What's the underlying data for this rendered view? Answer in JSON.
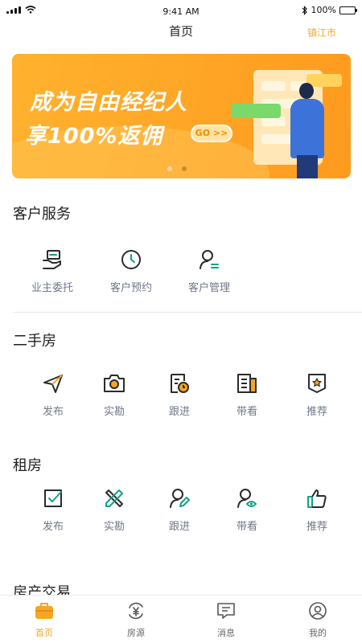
{
  "status_bar": {
    "time": "9:41 AM",
    "battery": "100%"
  },
  "nav": {
    "title": "首页",
    "city": "镇江市"
  },
  "banner": {
    "line1": "成为自由经纪人",
    "line2": "享100%返佣",
    "go": "GO >>",
    "slide_count": 2,
    "active_slide": 2
  },
  "customer_service": {
    "title": "客户服务",
    "items": [
      {
        "label": "业主委托",
        "icon": "hand-house-icon"
      },
      {
        "label": "客户预约",
        "icon": "clock-icon"
      },
      {
        "label": "客户管理",
        "icon": "user-manage-icon"
      }
    ]
  },
  "second_hand": {
    "title": "二手房",
    "items": [
      {
        "label": "发布",
        "icon": "send-icon"
      },
      {
        "label": "实勘",
        "icon": "camera-icon"
      },
      {
        "label": "跟进",
        "icon": "followup-icon"
      },
      {
        "label": "带看",
        "icon": "building-icon"
      },
      {
        "label": "推荐",
        "icon": "star-badge-icon"
      }
    ]
  },
  "rental": {
    "title": "租房",
    "items": [
      {
        "label": "发布",
        "icon": "check-box-icon"
      },
      {
        "label": "实勘",
        "icon": "pencil-ruler-icon"
      },
      {
        "label": "跟进",
        "icon": "user-edit-icon"
      },
      {
        "label": "带看",
        "icon": "user-eye-icon"
      },
      {
        "label": "推荐",
        "icon": "thumbs-up-icon"
      }
    ]
  },
  "next_section": {
    "title": "房产交易"
  },
  "tabbar": [
    {
      "label": "首页",
      "icon": "home-briefcase-icon",
      "active": true
    },
    {
      "label": "房源",
      "icon": "yen-refresh-icon",
      "active": false
    },
    {
      "label": "消息",
      "icon": "message-icon",
      "active": false
    },
    {
      "label": "我的",
      "icon": "profile-icon",
      "active": false
    }
  ],
  "colors": {
    "accent": "#F5A623",
    "icon_dark": "#2B2B2B",
    "icon_green": "#16A085",
    "icon_orange": "#F5A623",
    "label": "#707888"
  }
}
